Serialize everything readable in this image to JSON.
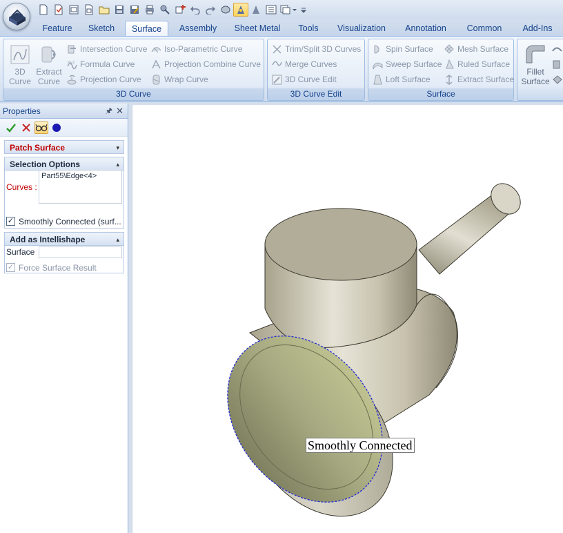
{
  "tabs": [
    {
      "label": "Feature"
    },
    {
      "label": "Sketch"
    },
    {
      "label": "Surface"
    },
    {
      "label": "Assembly"
    },
    {
      "label": "Sheet Metal"
    },
    {
      "label": "Tools"
    },
    {
      "label": "Visualization"
    },
    {
      "label": "Annotation"
    },
    {
      "label": "Common"
    },
    {
      "label": "Add-Ins"
    }
  ],
  "ribbon": {
    "curve3d": {
      "group_label": "3D Curve",
      "big_3d_curve": "3D\nCurve",
      "big_3d_curve_l1": "3D",
      "big_3d_curve_l2": "Curve",
      "big_extract_l1": "Extract",
      "big_extract_l2": "Curve",
      "intersection_curve": "Intersection Curve",
      "formula_curve": "Formula Curve",
      "projection_curve": "Projection Curve",
      "iso_parametric_curve": "Iso-Parametric Curve",
      "projection_combine_curve": "Projection Combine Curve",
      "wrap_curve": "Wrap Curve"
    },
    "curve3d_edit": {
      "group_label": "3D Curve Edit",
      "trim_split": "Trim/Split 3D Curves",
      "merge_curves": "Merge Curves",
      "curve_edit": "3D Curve Edit"
    },
    "surface": {
      "group_label": "Surface",
      "spin_surface": "Spin Surface",
      "sweep_surface": "Sweep Surface",
      "loft_surface": "Loft Surface",
      "mesh_surface": "Mesh Surface",
      "ruled_surface": "Ruled Surface",
      "extract_surface": "Extract Surface"
    },
    "fillet": {
      "label_l1": "Fillet",
      "label_l2": "Surface"
    }
  },
  "properties": {
    "title": "Properties",
    "pin_icon": "pin-icon",
    "close_icon": "close-icon",
    "feature_title": "Patch Surface",
    "selection_options": {
      "header": "Selection Options",
      "curves_label": "Curves :",
      "curves_value": "Part55\\Edge<4>",
      "smoothly_connected_label": "Smoothly Connected (surf...",
      "smoothly_connected_checked": true
    },
    "intellishape": {
      "header": "Add as Intellishape",
      "surface_label": "Surface",
      "surface_value": "",
      "force_surface_label": "Force Surface Result",
      "force_surface_checked": true
    }
  },
  "viewport": {
    "tooltip_label": "Smoothly Connected"
  },
  "colors": {
    "ribbon_bg": "#dbe6f4",
    "accent_blue": "#15428b",
    "required_red": "#c00000",
    "model_body": "#c9c4ad",
    "selection_edge": "#1f2bd6"
  }
}
